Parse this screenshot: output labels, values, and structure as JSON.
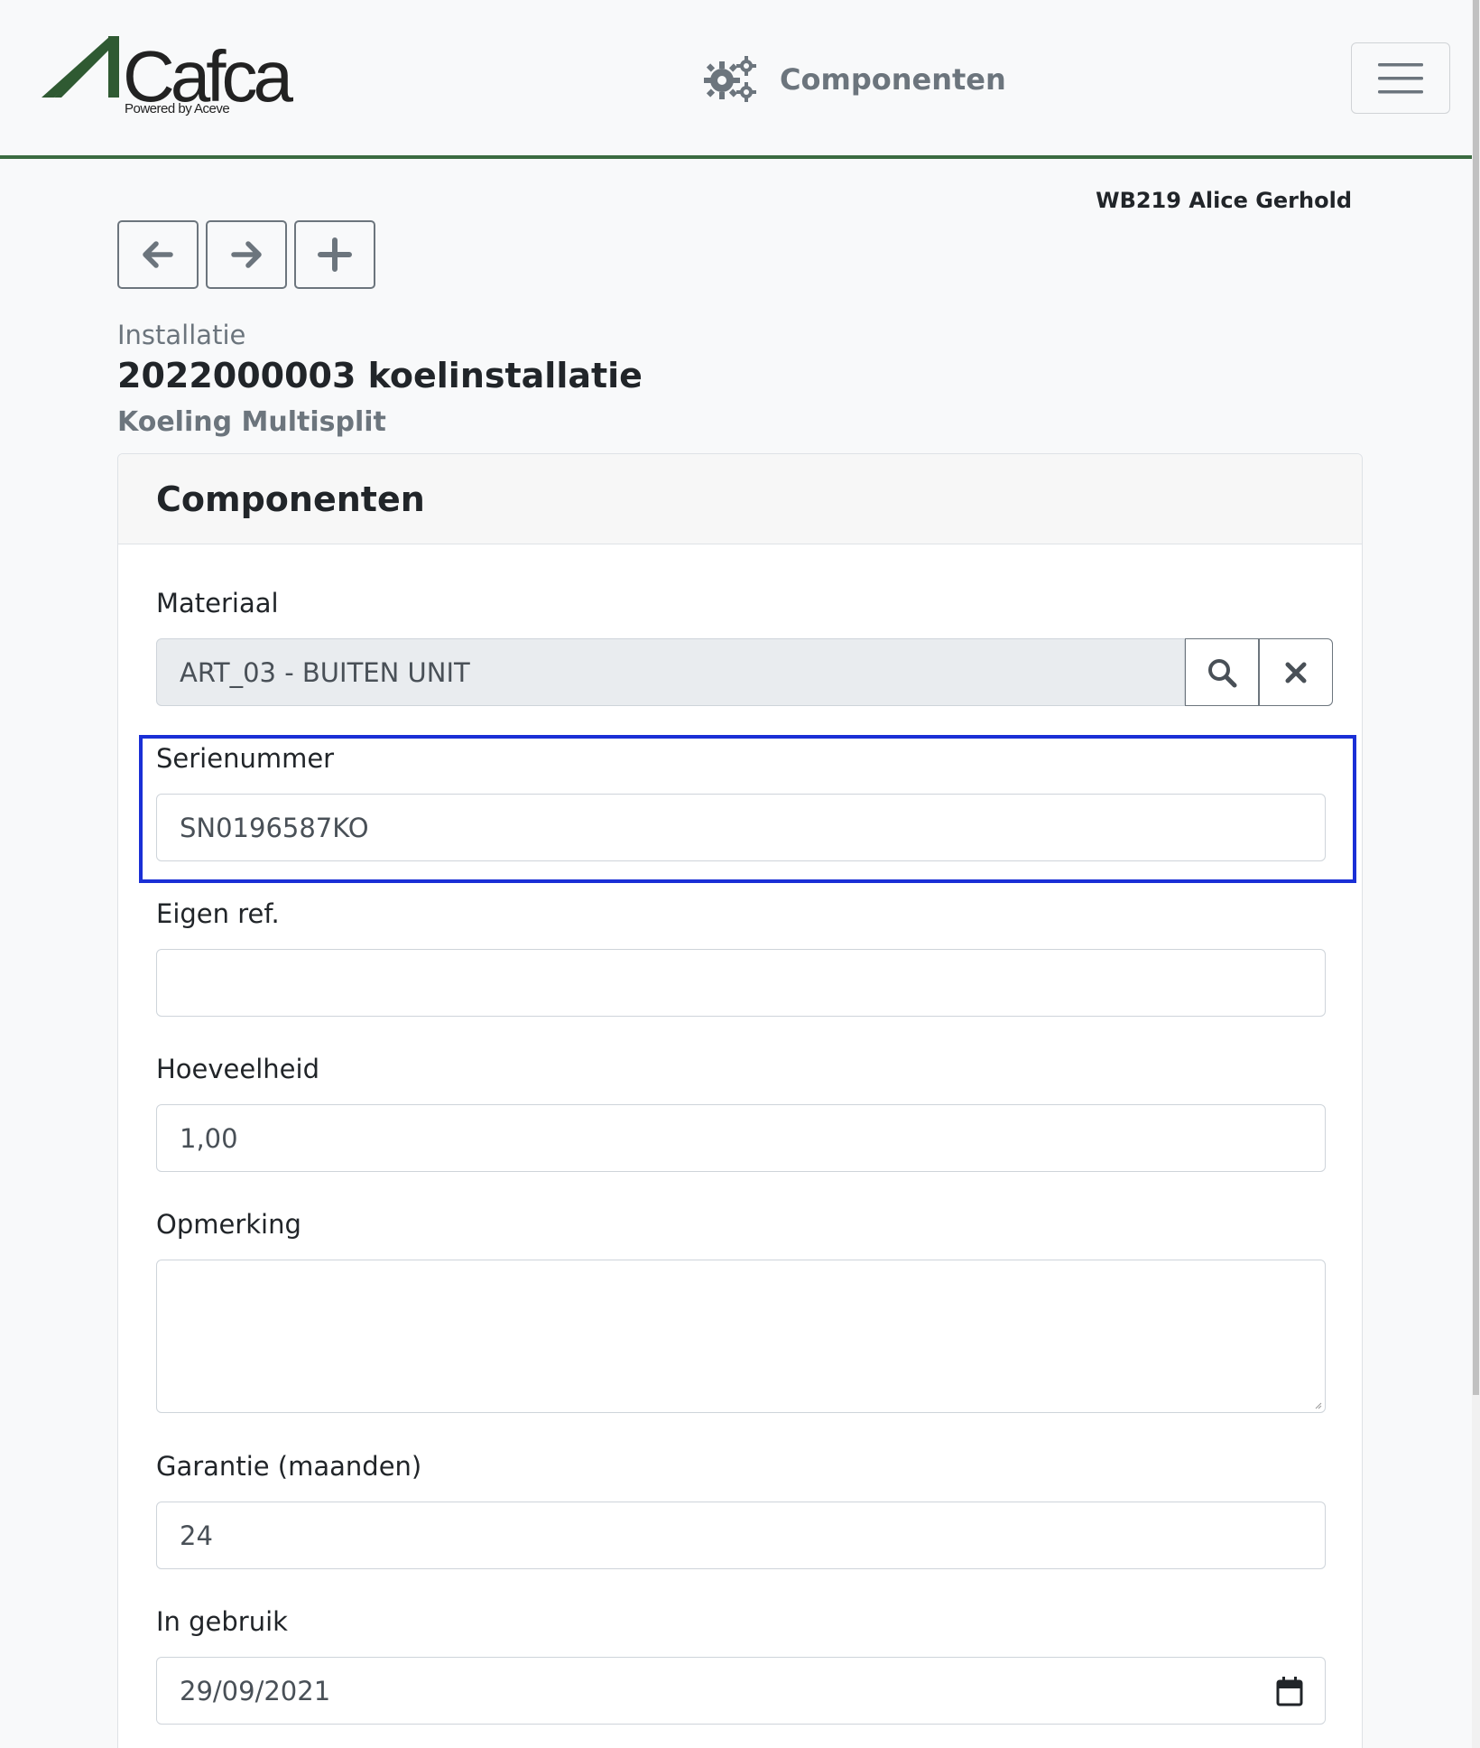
{
  "header": {
    "logo_text": "Cafca",
    "logo_tagline": "Powered by Aceve",
    "page_title": "Componenten",
    "page_icon": "gears-icon",
    "menu_icon": "hamburger-icon"
  },
  "user": {
    "display": "WB219 Alice Gerhold"
  },
  "actions": [
    {
      "name": "back",
      "icon": "arrow-left-icon"
    },
    {
      "name": "forward",
      "icon": "arrow-right-icon"
    },
    {
      "name": "add",
      "icon": "plus-icon"
    }
  ],
  "record": {
    "type_label": "Installatie",
    "title": "2022000003 koelinstallatie",
    "subtitle": "Koeling Multisplit"
  },
  "card": {
    "title": "Componenten",
    "fields": {
      "materiaal": {
        "label": "Materiaal",
        "value": "ART_03 - BUITEN UNIT"
      },
      "serienummer": {
        "label": "Serienummer",
        "value": "SN0196587KO"
      },
      "eigen_ref": {
        "label": "Eigen ref.",
        "value": ""
      },
      "hoeveelheid": {
        "label": "Hoeveelheid",
        "value": "1,00"
      },
      "opmerking": {
        "label": "Opmerking",
        "value": ""
      },
      "garantie": {
        "label": "Garantie (maanden)",
        "value": "24"
      },
      "in_gebruik": {
        "label": "In gebruik",
        "value": "29/09/2021"
      }
    }
  },
  "colors": {
    "brand_green": "#3b6b41",
    "highlight": "#1a2fd6",
    "muted": "#6c757d"
  }
}
